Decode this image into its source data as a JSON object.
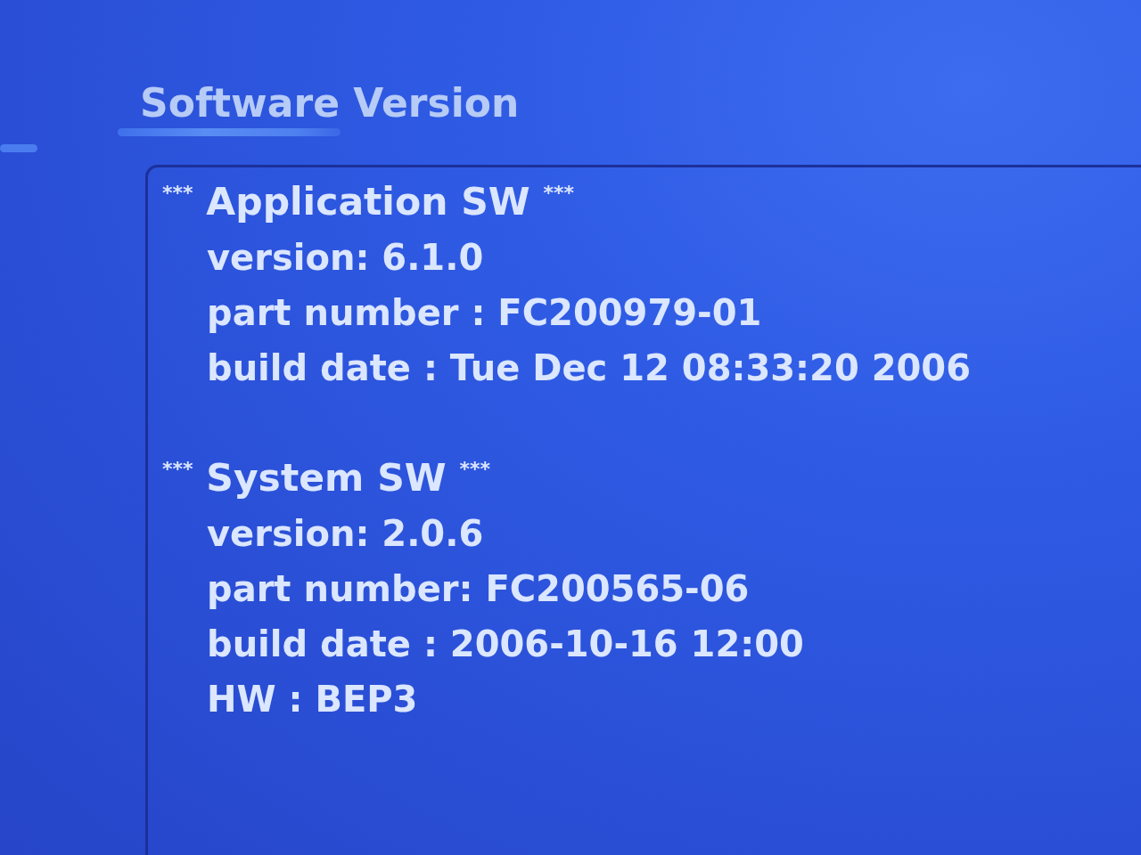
{
  "title": "Software Version",
  "sections": [
    {
      "heading": "$^{***}$ Application SW $^{***}$",
      "lines": [
        "version: 6.1.0",
        "part number : FC200979-01",
        "build date : Tue Dec 12 08:33:20 2006"
      ]
    },
    {
      "heading": "$^{***}$ System SW $^{***}$",
      "lines": [
        "version: 2.0.6",
        "part number: FC200565-06",
        "build date : 2006-10-16 12:00",
        "HW : BEP3"
      ]
    }
  ]
}
